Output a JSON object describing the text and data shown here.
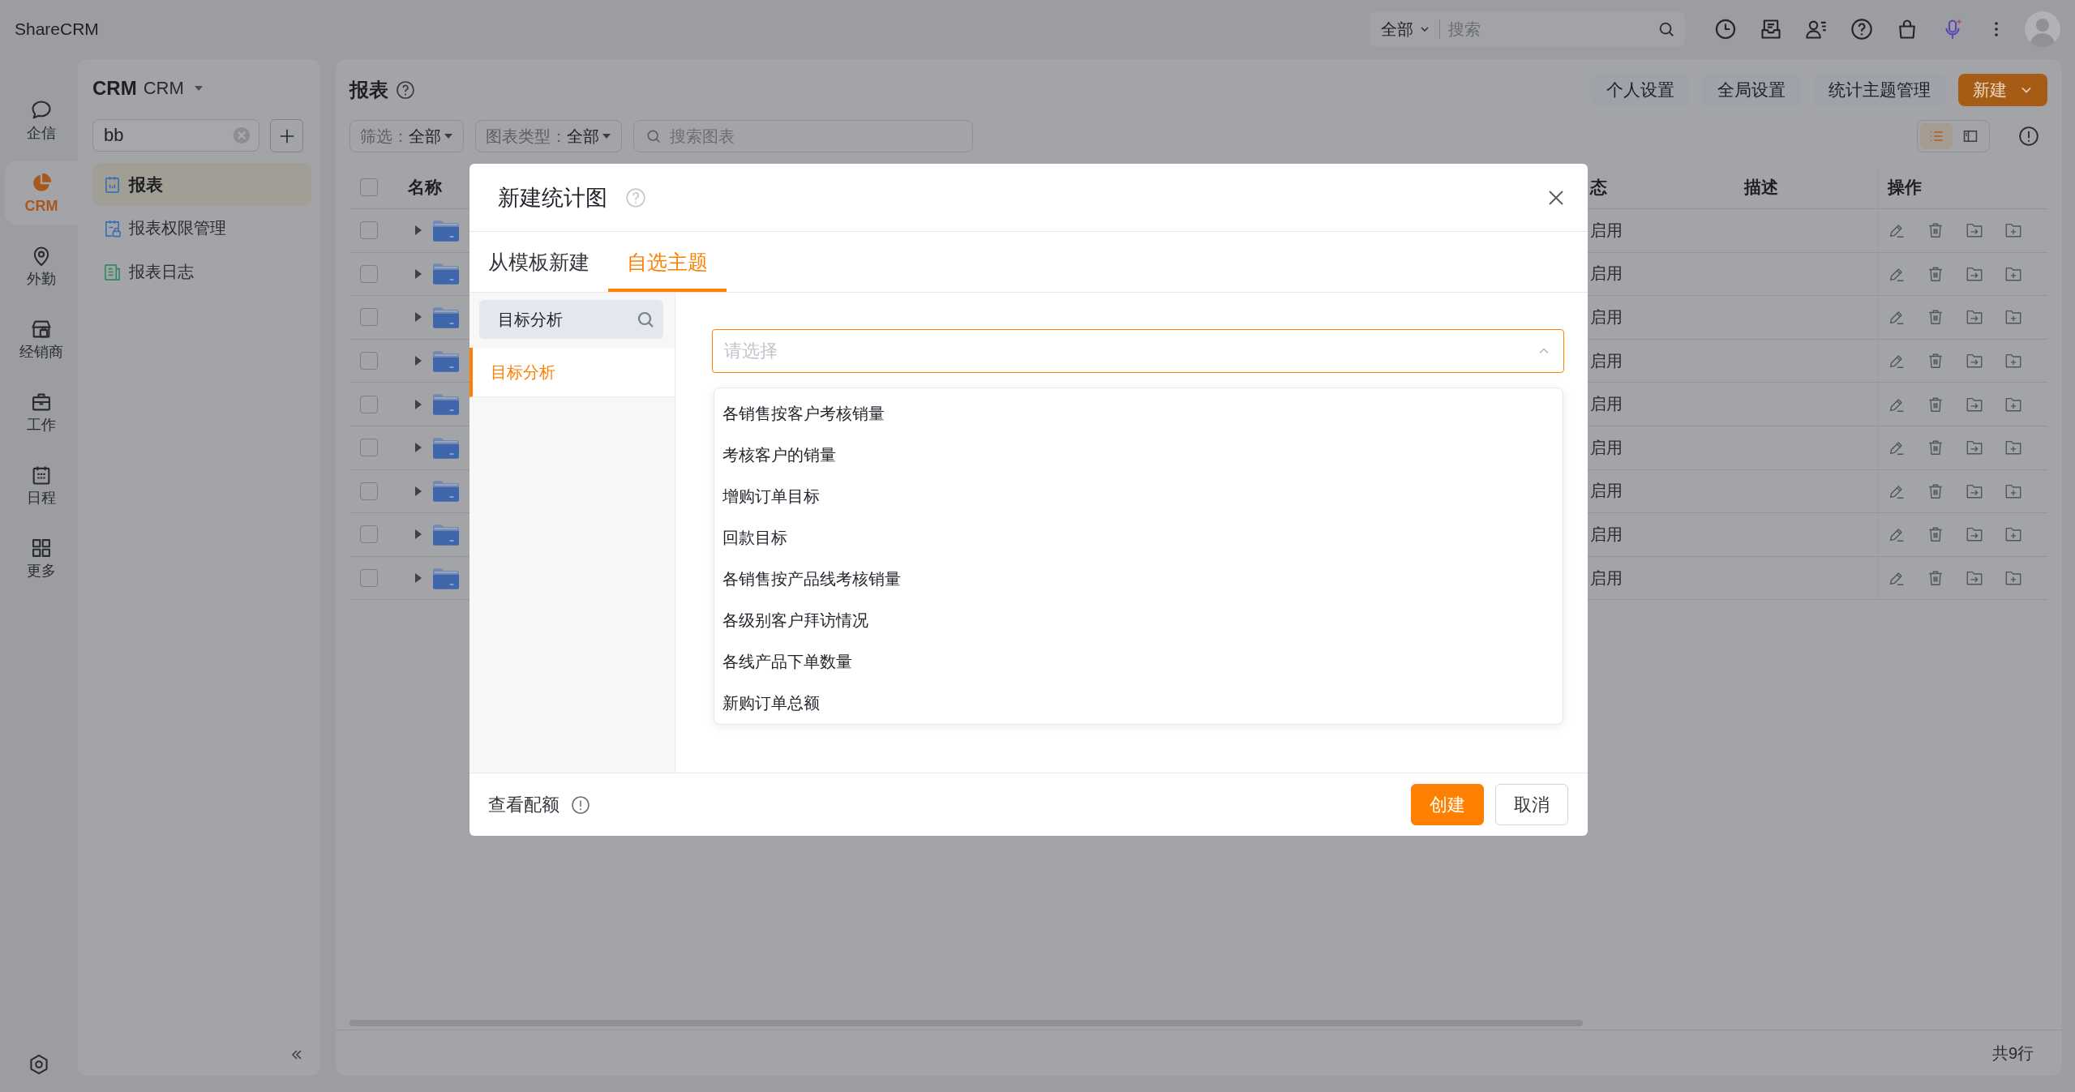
{
  "top_bar": {
    "app_name": "ShareCRM",
    "search": {
      "scope": "全部",
      "placeholder": "搜索"
    }
  },
  "nav_rail": [
    {
      "label": "企信",
      "selected": false
    },
    {
      "label": "CRM",
      "selected": true
    },
    {
      "label": "外勤",
      "selected": false
    },
    {
      "label": "经销商",
      "selected": false
    },
    {
      "label": "工作",
      "selected": false
    },
    {
      "label": "日程",
      "selected": false
    },
    {
      "label": "更多",
      "selected": false
    }
  ],
  "sidebar": {
    "title": "CRM",
    "subtitle": "CRM",
    "search": {
      "value": "bb"
    },
    "items": [
      {
        "label": "报表",
        "selected": true
      },
      {
        "label": "报表权限管理",
        "selected": false
      },
      {
        "label": "报表日志",
        "selected": false
      }
    ]
  },
  "main": {
    "title": "报表",
    "buttons": [
      {
        "label": "个人设置",
        "kind": "default"
      },
      {
        "label": "全局设置",
        "kind": "default"
      },
      {
        "label": "统计主题管理",
        "kind": "default"
      },
      {
        "label": "新建",
        "kind": "primary"
      }
    ],
    "filters": [
      {
        "label": "筛选：",
        "value": "全部"
      },
      {
        "label": "图表类型：",
        "value": "全部"
      }
    ],
    "search": {
      "placeholder": "搜索图表"
    },
    "views": [
      {
        "selected": true
      },
      {
        "selected": false
      }
    ],
    "table": {
      "header_checkbox": {
        "checked": false
      },
      "columns": [
        "名称",
        "态",
        "描述",
        "操作"
      ],
      "rows": [
        {
          "checked": false,
          "expanded": false,
          "status": "启用"
        },
        {
          "checked": false,
          "expanded": false,
          "status": "启用"
        },
        {
          "checked": false,
          "expanded": false,
          "status": "启用"
        },
        {
          "checked": false,
          "expanded": false,
          "status": "启用"
        },
        {
          "checked": false,
          "expanded": false,
          "status": "启用"
        },
        {
          "checked": false,
          "expanded": false,
          "status": "启用"
        },
        {
          "checked": false,
          "expanded": false,
          "status": "启用"
        },
        {
          "checked": false,
          "expanded": false,
          "status": "启用"
        },
        {
          "checked": false,
          "expanded": false,
          "status": "启用"
        }
      ],
      "row_count": "共9行"
    }
  },
  "modal": {
    "title": "新建统计图",
    "tabs": [
      {
        "label": "从模板新建",
        "selected": false
      },
      {
        "label": "自选主题",
        "selected": true
      }
    ],
    "theme_search": {
      "value": "目标分析"
    },
    "themes": [
      {
        "label": "目标分析",
        "selected": true
      }
    ],
    "select": {
      "placeholder": "请选择",
      "expanded": true,
      "options": [
        "各销售按客户考核销量",
        "考核客户的销量",
        "增购订单目标",
        "回款目标",
        "各销售按产品线考核销量",
        "各级别客户拜访情况",
        "各线产品下单数量",
        "新购订单总额"
      ]
    },
    "quota_link": "查看配额",
    "buttons": [
      {
        "label": "创建",
        "kind": "primary"
      },
      {
        "label": "取消",
        "kind": "default"
      }
    ]
  }
}
